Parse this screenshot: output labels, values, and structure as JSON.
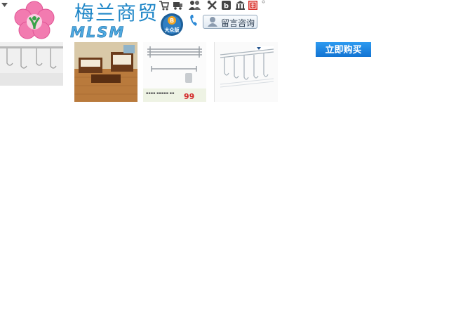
{
  "brand": {
    "name_cn": "梅兰商贸",
    "name_en": "MLSM",
    "badge_text": "大众版"
  },
  "toolbar": {
    "icons": [
      "cart-icon",
      "truck-icon",
      "users-icon",
      "tools-icon",
      "blog-icon",
      "bank-icon",
      "red-seal-icon"
    ]
  },
  "message_button": {
    "label": "留言咨询"
  },
  "products": [
    {
      "name": "towel-bar-rack-thumbnail"
    },
    {
      "name": "living-room-furniture-thumbnail"
    },
    {
      "name": "bath-shelf-thumbnail",
      "price": "99"
    },
    {
      "name": "wall-rack-thumbnail"
    }
  ],
  "buy_button": {
    "label": "立即购买"
  },
  "colors": {
    "brand_blue": "#1e86c7",
    "buy_button": "#1a85e6",
    "logo_pink": "#f06aa8"
  }
}
